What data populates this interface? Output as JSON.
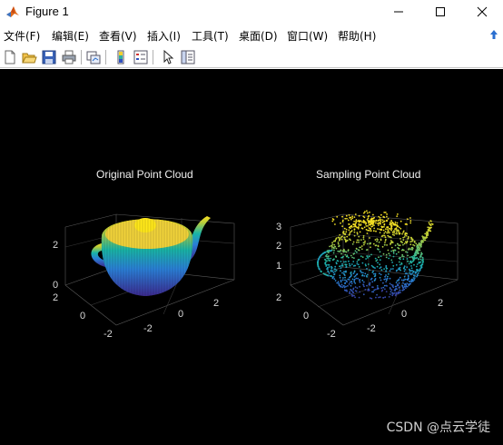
{
  "window": {
    "title": "Figure 1",
    "icon": "matlab-logo-icon"
  },
  "menu": [
    "文件(F)",
    "编辑(E)",
    "查看(V)",
    "插入(I)",
    "工具(T)",
    "桌面(D)",
    "窗口(W)",
    "帮助(H)"
  ],
  "toolbar": [
    "new-figure-icon",
    "open-file-icon",
    "save-icon",
    "print-icon",
    "link-plot-icon",
    "insert-colorbar-icon",
    "insert-legend-icon",
    "edit-plot-arrow-icon",
    "property-inspector-icon"
  ],
  "plots": [
    {
      "title": "Original Point Cloud",
      "z_ticks": [
        "2",
        "0"
      ],
      "y_ticks": [
        "2",
        "0",
        "-2"
      ],
      "x_ticks": [
        "-2",
        "0",
        "2"
      ]
    },
    {
      "title": "Sampling Point Cloud",
      "z_ticks": [
        "3",
        "2",
        "1"
      ],
      "y_ticks": [
        "2",
        "0",
        "-2"
      ],
      "x_ticks": [
        "-2",
        "0",
        "2"
      ]
    }
  ],
  "watermark": "CSDN @点云学徒",
  "colors": {
    "figure_bg": "#000000",
    "colormap_low": "#3b2a8f",
    "colormap_mid": "#19b4a6",
    "colormap_high": "#f9e022"
  }
}
